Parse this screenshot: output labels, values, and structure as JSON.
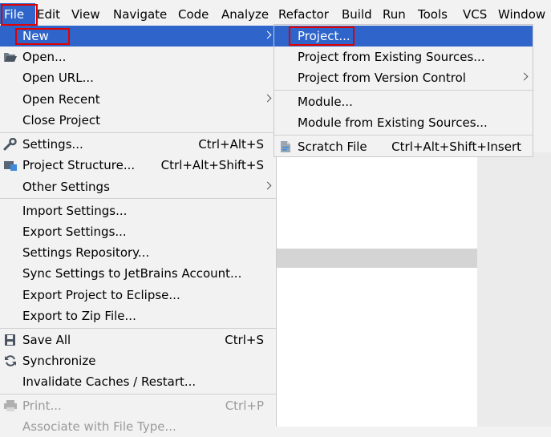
{
  "menubar": {
    "items": [
      "File",
      "Edit",
      "View",
      "Navigate",
      "Code",
      "Analyze",
      "Refactor",
      "Build",
      "Run",
      "Tools",
      "VCS",
      "Window"
    ]
  },
  "file_menu": {
    "new": "New",
    "open": "Open...",
    "open_url": "Open URL...",
    "open_recent": "Open Recent",
    "close_project": "Close Project",
    "settings": "Settings...",
    "settings_sc": "Ctrl+Alt+S",
    "project_structure": "Project Structure...",
    "project_structure_sc": "Ctrl+Alt+Shift+S",
    "other_settings": "Other Settings",
    "import_settings": "Import Settings...",
    "export_settings": "Export Settings...",
    "settings_repository": "Settings Repository...",
    "sync_settings": "Sync Settings to JetBrains Account...",
    "export_eclipse": "Export Project to Eclipse...",
    "export_zip": "Export to Zip File...",
    "save_all": "Save All",
    "save_all_sc": "Ctrl+S",
    "synchronize": "Synchronize",
    "invalidate_caches": "Invalidate Caches / Restart...",
    "print": "Print...",
    "print_sc": "Ctrl+P",
    "associate": "Associate with File Type..."
  },
  "new_submenu": {
    "project": "Project...",
    "project_existing": "Project from Existing Sources...",
    "project_vcs": "Project from Version Control",
    "module": "Module...",
    "module_existing": "Module from Existing Sources...",
    "scratch_file": "Scratch File",
    "scratch_file_sc": "Ctrl+Alt+Shift+Insert"
  },
  "colors": {
    "highlight": "#2f65ca",
    "annotation": "#e00000",
    "menu_bg": "#f2f2f2"
  }
}
